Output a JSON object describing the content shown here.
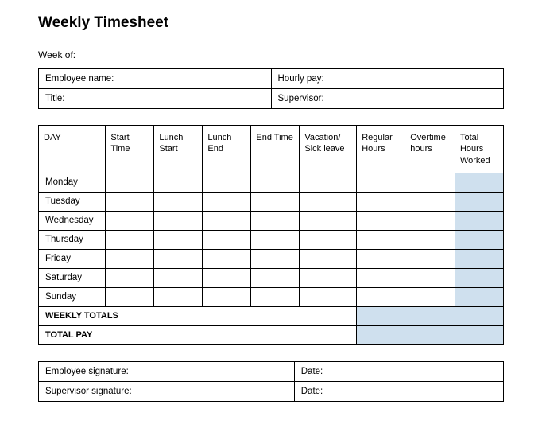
{
  "title": "Weekly Timesheet",
  "week_of_label": "Week of:",
  "header": {
    "employee_name_label": "Employee name:",
    "hourly_pay_label": "Hourly pay:",
    "title_label": "Title:",
    "supervisor_label": "Supervisor:"
  },
  "columns": {
    "day": "DAY",
    "start_time": "Start Time",
    "lunch_start": "Lunch Start",
    "lunch_end": "Lunch End",
    "end_time": "End Time",
    "vacation_sick": "Vacation/ Sick leave",
    "regular_hours": "Regular Hours",
    "overtime_hours": "Overtime hours",
    "total_hours": "Total Hours Worked"
  },
  "days": {
    "mon": "Monday",
    "tue": "Tuesday",
    "wed": "Wednesday",
    "thu": "Thursday",
    "fri": "Friday",
    "sat": "Saturday",
    "sun": "Sunday"
  },
  "weekly_totals_label": "WEEKLY TOTALS",
  "total_pay_label": "TOTAL PAY",
  "signatures": {
    "employee_sig_label": "Employee signature:",
    "supervisor_sig_label": "Supervisor signature:",
    "date_label": "Date:"
  }
}
